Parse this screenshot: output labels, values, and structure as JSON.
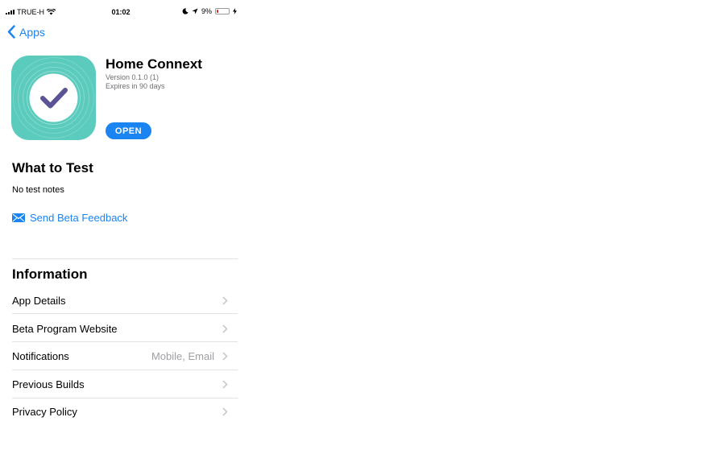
{
  "status_bar": {
    "carrier": "TRUE-H",
    "time": "01:02",
    "battery_percent": "9%",
    "battery_level": 0.09
  },
  "nav": {
    "back_label": "Apps"
  },
  "app": {
    "name": "Home Connext",
    "version": "Version 0.1.0 (1)",
    "expiry": "Expires in 90 days",
    "open_label": "OPEN",
    "icon_color": "#5bcbbd",
    "check_color": "#5b5494"
  },
  "what_to_test": {
    "title": "What to Test",
    "notes": "No test notes",
    "feedback_label": "Send Beta Feedback"
  },
  "information": {
    "title": "Information",
    "rows": [
      {
        "label": "App Details",
        "detail": ""
      },
      {
        "label": "Beta Program Website",
        "detail": ""
      },
      {
        "label": "Notifications",
        "detail": "Mobile, Email"
      },
      {
        "label": "Previous Builds",
        "detail": ""
      },
      {
        "label": "Privacy Policy",
        "detail": ""
      }
    ]
  },
  "colors": {
    "accent": "#1a84f0",
    "battery_low": "#e0262a"
  }
}
